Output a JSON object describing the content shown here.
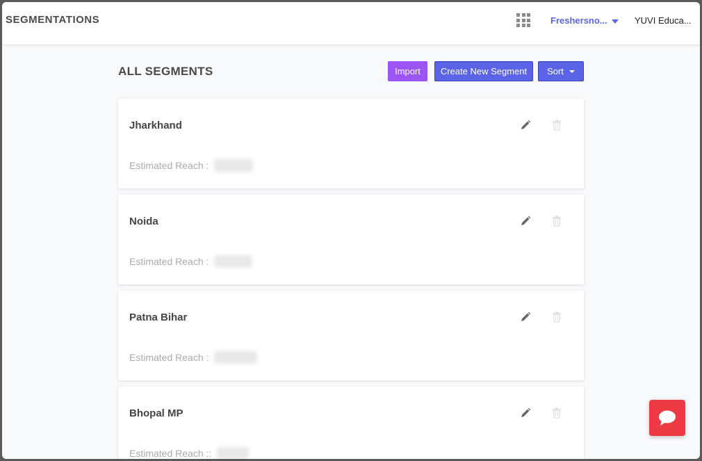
{
  "header": {
    "page_title": "SEGMENTATIONS",
    "account_name": "Freshersno...",
    "org_name": "YUVI Educa..."
  },
  "main": {
    "section_title": "ALL SEGMENTS",
    "buttons": {
      "import_label": "Import",
      "create_label": "Create New Segment",
      "sort_label": "Sort"
    },
    "segments": [
      {
        "name": "Jharkhand",
        "reach_label": "Estimated Reach :",
        "reach_value": "█████"
      },
      {
        "name": "Noida",
        "reach_label": "Estimated Reach :",
        "reach_value": "█████"
      },
      {
        "name": "Patna Bihar",
        "reach_label": "Estimated Reach :",
        "reach_value": "██████"
      },
      {
        "name": "Bhopal MP",
        "reach_label": "Estimated Reach ::",
        "reach_value": "████"
      }
    ]
  },
  "icons": {
    "apps": "grid-icon",
    "edit": "pencil-icon",
    "delete": "trash-icon",
    "chat": "chat-bubble-icon"
  },
  "colors": {
    "accent": "#5b63e6",
    "import_button": "#9b55f3",
    "chat_button": "#ee3b43"
  }
}
